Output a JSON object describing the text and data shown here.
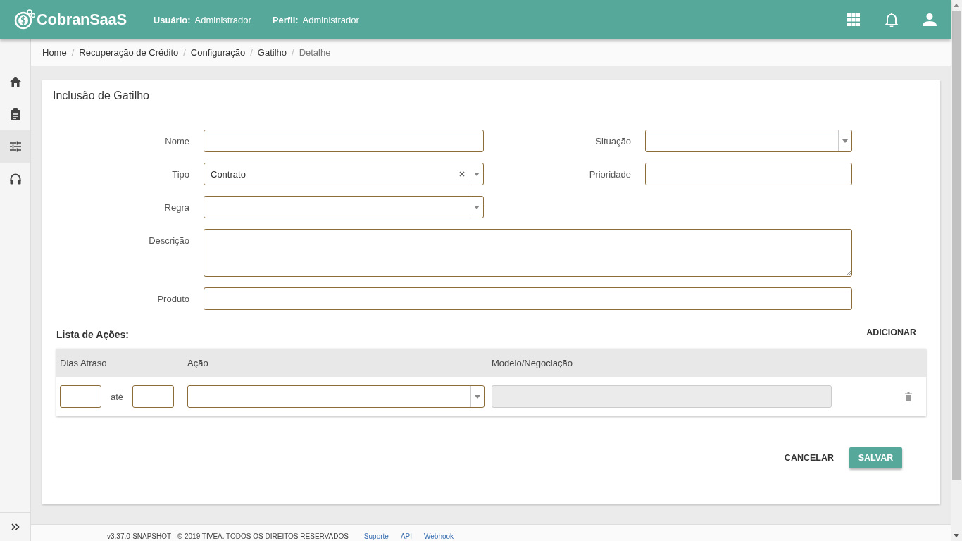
{
  "header": {
    "logo": "CobranSaaS",
    "user_label": "Usuário:",
    "user": "Administrador",
    "profile_label": "Perfil:",
    "profile": "Administrador"
  },
  "sidebar": {
    "items": [
      {
        "selected": false
      },
      {
        "selected": false
      },
      {
        "selected": true
      },
      {
        "selected": false
      }
    ]
  },
  "breadcrumb": {
    "separators": [
      "/",
      "/",
      "/",
      "/"
    ],
    "items": [
      {
        "label": "Home",
        "current": false
      },
      {
        "label": "Recuperação de Crédito",
        "current": false
      },
      {
        "label": "Configuração",
        "current": false
      },
      {
        "label": "Gatilho",
        "current": false
      },
      {
        "label": "Detalhe",
        "current": true
      }
    ]
  },
  "form": {
    "title": "Inclusão de Gatilho",
    "rows": [
      [
        {
          "label": "Nome",
          "kind": "text"
        },
        {
          "label": "Situação",
          "kind": "select"
        }
      ],
      [
        {
          "label": "Tipo",
          "kind": "select",
          "value": "Contrato",
          "clearable": true
        },
        {
          "label": "Prioridade",
          "kind": "text"
        }
      ],
      [
        {
          "label": "Regra",
          "kind": "select"
        }
      ],
      [
        {
          "label": "Descrição",
          "kind": "textarea",
          "wide": true
        }
      ],
      [
        {
          "label": "Produto",
          "kind": "text",
          "wide": true
        }
      ]
    ]
  },
  "actions": {
    "title": "Lista de Ações:",
    "add_button": "ADICIONAR",
    "columns": [
      "Dias Atraso",
      "Ação",
      "Modelo/Negociação"
    ],
    "rows": [
      {
        "range_label": "até",
        "model_disabled": true
      }
    ]
  },
  "buttons": {
    "cancel": "CANCELAR",
    "save": "SALVAR"
  },
  "footer": {
    "text": "v3.37.0-SNAPSHOT - © 2019 TIVEA. TODOS OS DIREITOS RESERVADOS",
    "links": [
      "Suporte",
      "API",
      "Webhook"
    ]
  }
}
